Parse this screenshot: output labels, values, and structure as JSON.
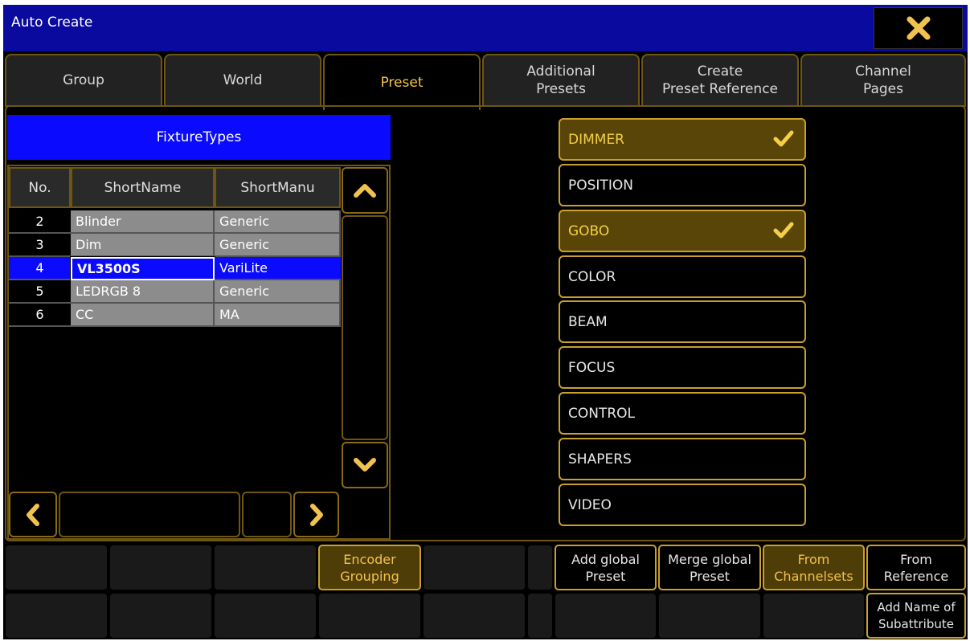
{
  "window": {
    "title": "Auto Create"
  },
  "tabs": [
    {
      "label": "Group"
    },
    {
      "label": "World"
    },
    {
      "label": "Preset"
    },
    {
      "label": "Additional\nPresets"
    },
    {
      "label": "Create\nPreset Reference"
    },
    {
      "label": "Channel\nPages"
    }
  ],
  "fixture_types": {
    "title": "FixtureTypes",
    "columns": [
      "No.",
      "ShortName",
      "ShortManu"
    ],
    "rows": [
      {
        "no": "2",
        "short_name": "Blinder",
        "short_manu": "Generic"
      },
      {
        "no": "3",
        "short_name": "Dim",
        "short_manu": "Generic"
      },
      {
        "no": "4",
        "short_name": "VL3500S",
        "short_manu": "VariLite"
      },
      {
        "no": "5",
        "short_name": "LEDRGB 8",
        "short_manu": "Generic"
      },
      {
        "no": "6",
        "short_name": "CC",
        "short_manu": "MA"
      }
    ]
  },
  "attributes": [
    {
      "label": "DIMMER",
      "checked": true
    },
    {
      "label": "POSITION",
      "checked": false
    },
    {
      "label": "GOBO",
      "checked": true
    },
    {
      "label": "COLOR",
      "checked": false
    },
    {
      "label": "BEAM",
      "checked": false
    },
    {
      "label": "FOCUS",
      "checked": false
    },
    {
      "label": "CONTROL",
      "checked": false
    },
    {
      "label": "SHAPERS",
      "checked": false
    },
    {
      "label": "VIDEO",
      "checked": false
    }
  ],
  "bottom": {
    "encoder_grouping": "Encoder\nGrouping",
    "add_global_preset": "Add global\nPreset",
    "merge_global_preset": "Merge global\nPreset",
    "from_channelsets": "From\nChannelsets",
    "from_reference": "From\nReference",
    "add_name_of_subattribute": "Add Name of\nSubattribute"
  },
  "colors": {
    "title_bar": "#0a0a9e",
    "accent_gold": "#c9a02e",
    "selection_blue": "#0a0aff",
    "active_text": "#f1c24d"
  }
}
